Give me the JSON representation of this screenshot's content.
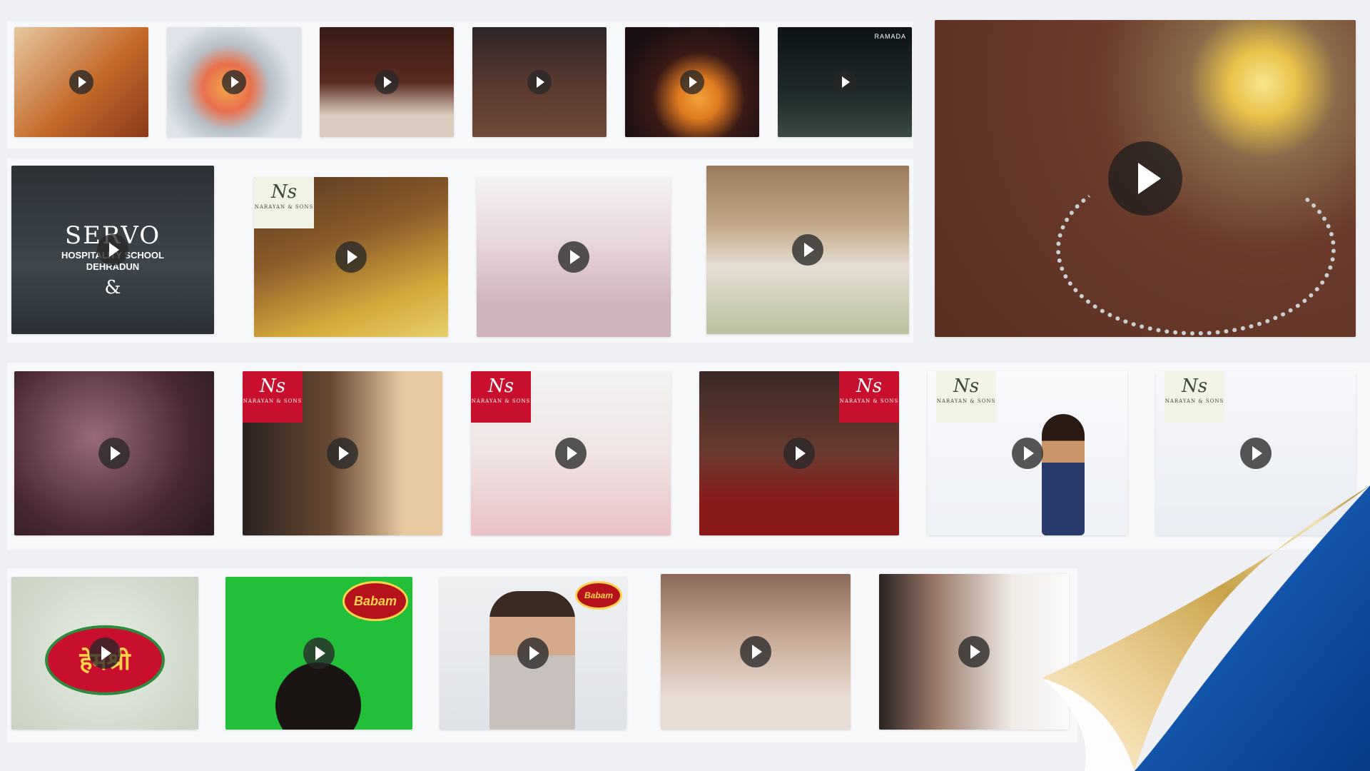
{
  "logos": {
    "servo_title": "SERVO",
    "servo_subtitle_1": "HOSPITALITY SCHOOL",
    "servo_subtitle_2": "DEHRADUN",
    "servo_amp": "&",
    "ns_monogram": "Ns",
    "ns_name": "NARAYAN & SONS",
    "ramada": "RAMADA",
    "babam": "Babam",
    "hemshri": "हेमश्री"
  },
  "colors": {
    "page_bg": "#eef0f3",
    "ns_red": "#c8102e",
    "green_screen": "#22c03a",
    "curl_blue": "#0b4fa8",
    "curl_gold": "#c9a24a"
  },
  "icons": {
    "play": "play-icon",
    "page_curl": "page-curl-icon"
  }
}
